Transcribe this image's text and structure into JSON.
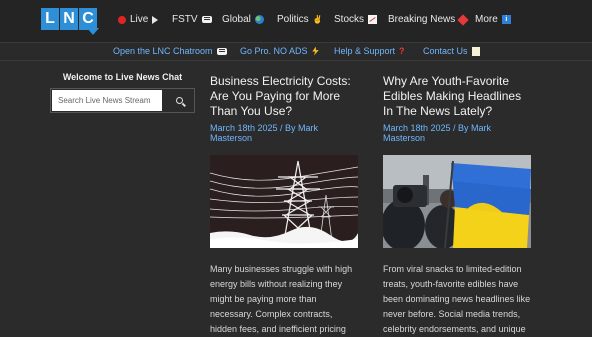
{
  "logo": {
    "letters": [
      "L",
      "N",
      "C"
    ]
  },
  "nav": {
    "items": [
      {
        "label": "Live",
        "icon": "live-dot-icon"
      },
      {
        "label": "FSTV",
        "icon": "chat-bubble-icon"
      },
      {
        "label": "Global",
        "icon": "globe-icon"
      },
      {
        "label": "Politics",
        "icon": "v-hand-icon"
      },
      {
        "label": "Stocks",
        "icon": "chart-icon"
      },
      {
        "label": "Breaking News",
        "icon": "burst-icon"
      },
      {
        "label": "More",
        "icon": "info-icon"
      }
    ]
  },
  "subnav": {
    "items": [
      {
        "label": "Open the LNC Chatroom",
        "icon": "chat-bubble-icon"
      },
      {
        "label": "Go Pro. NO ADS",
        "icon": "lightning-icon"
      },
      {
        "label": "Help & Support",
        "icon": "question-icon"
      },
      {
        "label": "Contact Us",
        "icon": "note-icon"
      }
    ]
  },
  "sidebar": {
    "title": "Welcome to Live News Chat",
    "search_placeholder": "Search Live News Stream"
  },
  "articles": [
    {
      "title": "Business Electricity Costs: Are You Paying for More Than You Use?",
      "meta": "March 18th 2025 / By Mark Masterson",
      "excerpt": "Many businesses struggle with high energy bills without realizing they might be paying more than necessary. Complex contracts, hidden fees, and inefficient pricing structures often inflate business [...]"
    },
    {
      "title": "Why Are Youth-Favorite Edibles Making Headlines In The News Lately?",
      "meta": "March 18th 2025 / By Mark Masterson",
      "excerpt": "From viral snacks to limited-edition treats, youth-favorite edibles have been dominating news headlines like never before. Social media trends, celebrity endorsements, and unique flavor innovations are driving"
    }
  ],
  "colors": {
    "accent": "#2f8fd6",
    "link": "#6fb7ff",
    "background": "#2b2b2b"
  }
}
